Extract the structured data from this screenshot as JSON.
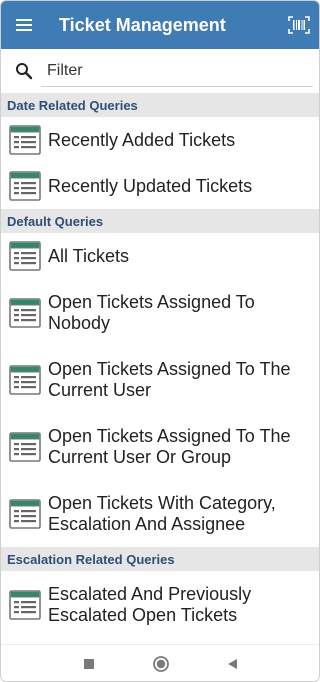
{
  "app": {
    "title": "Ticket Management"
  },
  "header_icons": {
    "menu": "hamburger-menu-icon",
    "scan": "barcode-scan-icon"
  },
  "filter": {
    "placeholder": "Filter",
    "icon": "search-icon"
  },
  "colors": {
    "appbar": "#3f7bb5",
    "section_bg": "#e6e6e6",
    "section_text": "#2e4e78",
    "list_icon": "#2f8a6a"
  },
  "sections": [
    {
      "title": "Date Related Queries",
      "items": [
        {
          "label": "Recently Added Tickets",
          "lines": 1
        },
        {
          "label": "Recently Updated Tickets",
          "lines": 1
        }
      ]
    },
    {
      "title": "Default Queries",
      "items": [
        {
          "label": "All Tickets",
          "lines": 1
        },
        {
          "label": "Open Tickets Assigned To Nobody",
          "lines": 2
        },
        {
          "label": "Open Tickets Assigned To The Current User",
          "lines": 2
        },
        {
          "label": "Open Tickets Assigned To The Current User Or Group",
          "lines": 2
        },
        {
          "label": "Open Tickets With Category, Escalation And Assignee",
          "lines": 2
        }
      ]
    },
    {
      "title": "Escalation Related Queries",
      "items": [
        {
          "label": "Escalated And Previously Escalated Open Tickets",
          "lines": 2
        }
      ]
    }
  ],
  "navbar": {
    "items": [
      "recent-apps-square-icon",
      "home-circle-icon",
      "back-triangle-icon"
    ]
  }
}
